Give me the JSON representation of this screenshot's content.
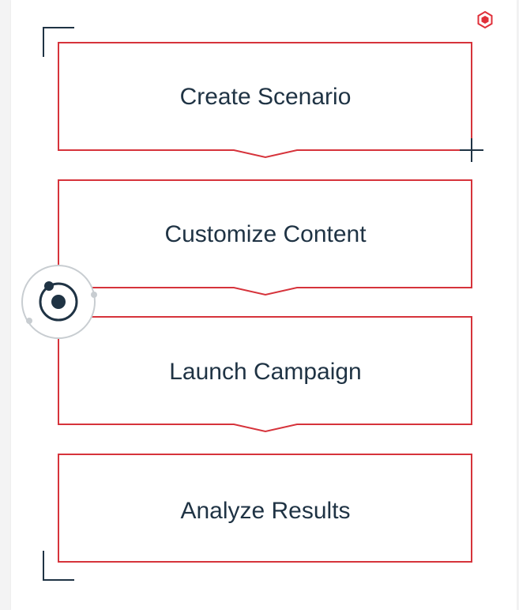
{
  "steps": [
    {
      "label": "Create Scenario"
    },
    {
      "label": "Customize Content"
    },
    {
      "label": "Launch Campaign"
    },
    {
      "label": "Analyze Results"
    }
  ],
  "icons": {
    "corner_badge": "hexagon-icon",
    "add": "plus-icon",
    "orbit": "orbit-target-icon"
  },
  "colors": {
    "border": "#d6333b",
    "text": "#1f3344",
    "accent": "#e0303a"
  }
}
